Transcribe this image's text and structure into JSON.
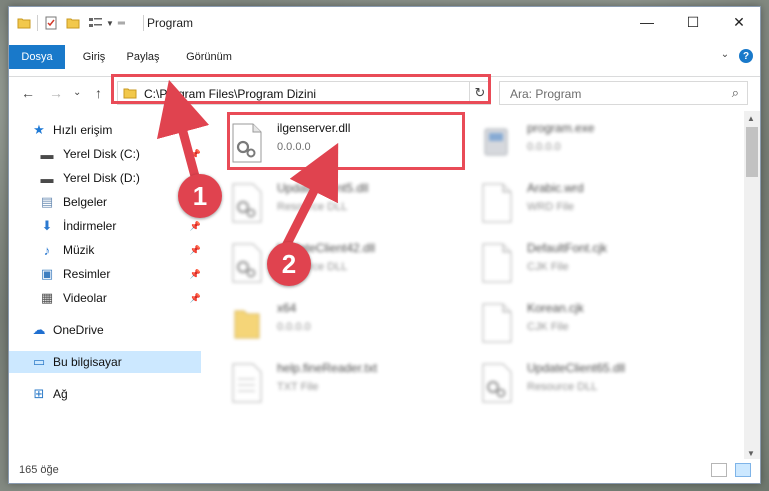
{
  "window": {
    "title": "Program",
    "tabs": [
      {
        "label": "Dosya"
      },
      {
        "label": "Giriş"
      },
      {
        "label": "Paylaş"
      },
      {
        "label": "Görünüm"
      }
    ],
    "controls": {
      "minimize": "—",
      "maximize": "☐",
      "close": "✕"
    }
  },
  "nav": {
    "back_icon": "←",
    "forward_icon": "→",
    "recent_icon": "⌄",
    "up_icon": "↑",
    "address": "C:\\Program Files\\Program Dizini",
    "address_dropdown": "⌄",
    "refresh_icon": "↻",
    "search_placeholder": "Ara: Program",
    "search_icon": "⌕"
  },
  "sidebar": {
    "items": [
      {
        "label": "Hızlı erişim",
        "icon": "star-icon",
        "glyph": "★",
        "color": "#1f7ad6"
      },
      {
        "label": "Yerel Disk (C:)",
        "icon": "drive-icon",
        "glyph": "▬",
        "color": "#4a4a4a"
      },
      {
        "label": "Yerel Disk (D:)",
        "icon": "drive-icon",
        "glyph": "▬",
        "color": "#4a4a4a"
      },
      {
        "label": "Belgeler",
        "icon": "documents-icon",
        "glyph": "▤",
        "color": "#6e8fb5"
      },
      {
        "label": "İndirmeler",
        "icon": "download-icon",
        "glyph": "⬇",
        "color": "#2b79d0"
      },
      {
        "label": "Müzik",
        "icon": "music-icon",
        "glyph": "♪",
        "color": "#2b79d0"
      },
      {
        "label": "Resimler",
        "icon": "pictures-icon",
        "glyph": "▣",
        "color": "#3f7fc0"
      },
      {
        "label": "Videolar",
        "icon": "videos-icon",
        "glyph": "▦",
        "color": "#505050"
      },
      {
        "label": "OneDrive",
        "icon": "cloud-icon",
        "glyph": "☁",
        "color": "#1f6fd0"
      },
      {
        "label": "Bu bilgisayar",
        "icon": "computer-icon",
        "glyph": "▭",
        "color": "#2d7bc8"
      },
      {
        "label": "Ağ",
        "icon": "network-icon",
        "glyph": "⊞",
        "color": "#2d7bc8"
      }
    ]
  },
  "files": [
    {
      "name": "ilgenserver.dll",
      "sub": "0.0.0.0",
      "type": "dll"
    },
    {
      "name": "program.exe",
      "sub": "0.0.0.0",
      "type": "exe"
    },
    {
      "name": "UpdateClient5.dll",
      "sub": "Resource DLL",
      "type": "dll"
    },
    {
      "name": "Arabic.wrd",
      "sub": "WRD File",
      "type": "doc"
    },
    {
      "name": "UpdateClient42.dll",
      "sub": "Resource DLL",
      "type": "dll"
    },
    {
      "name": "DefaultFont.cjk",
      "sub": "CJK File",
      "type": "doc"
    },
    {
      "name": "x64",
      "sub": "0.0.0.0",
      "type": "folder"
    },
    {
      "name": "Korean.cjk",
      "sub": "CJK File",
      "type": "doc"
    },
    {
      "name": "help.fineReader.txt",
      "sub": "TXT File",
      "type": "txt"
    },
    {
      "name": "UpdateClient65.dll",
      "sub": "Resource DLL",
      "type": "dll"
    }
  ],
  "status": {
    "item_count": "165 öğe"
  },
  "annotations": {
    "badge1": "1",
    "badge2": "2",
    "color": "#e0434f"
  }
}
